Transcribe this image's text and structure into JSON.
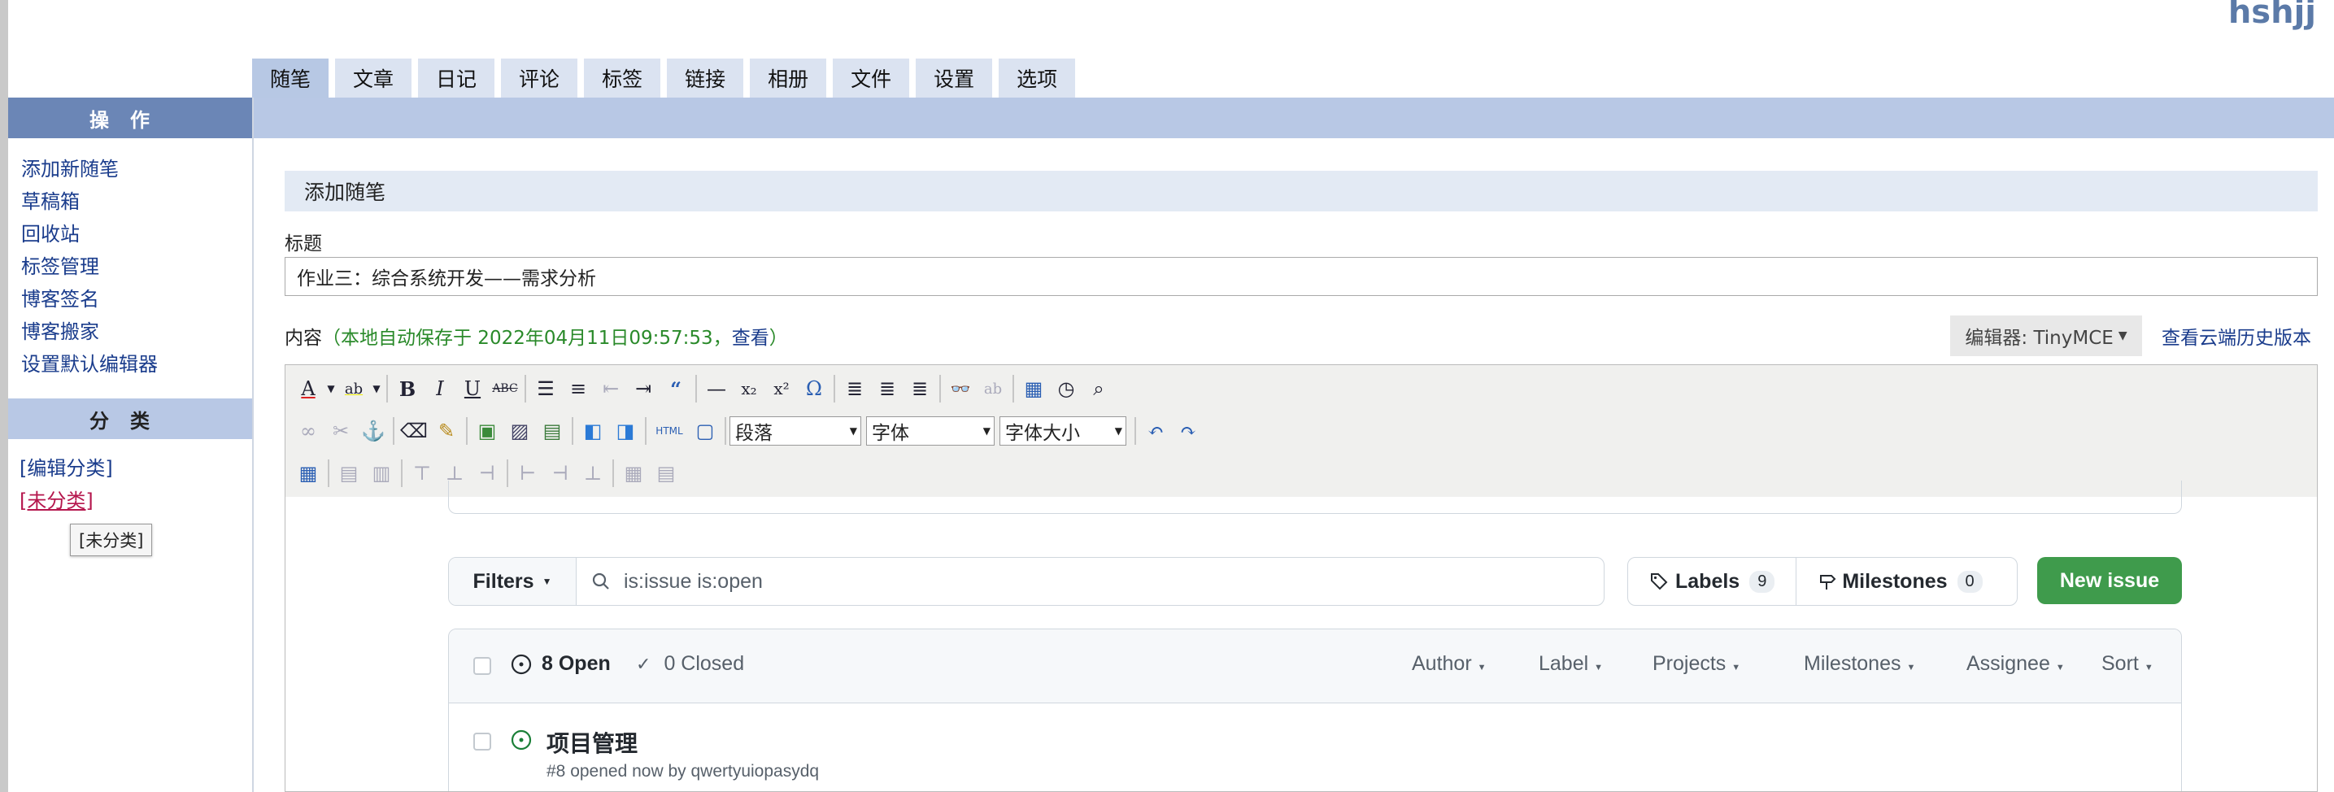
{
  "site_title": "hshjj",
  "tabs": [
    "随笔",
    "文章",
    "日记",
    "评论",
    "标签",
    "链接",
    "相册",
    "文件",
    "设置",
    "选项"
  ],
  "sidebar": {
    "ops_heading": "操作",
    "ops_links": [
      "添加新随笔",
      "草稿箱",
      "回收站",
      "标签管理",
      "博客签名",
      "博客搬家",
      "设置默认编辑器"
    ],
    "cat_heading": "分类",
    "cat_links": [
      "[编辑分类]",
      "[未分类]"
    ],
    "tooltip": "[未分类]"
  },
  "main": {
    "section_title": "添加随笔",
    "title_label": "标题",
    "title_value": "作业三：综合系统开发——需求分析",
    "content_label": "内容",
    "autosave_text": "（本地自动保存于 2022年04月11日09:57:53，",
    "view_link": "查看",
    "autosave_close": "）",
    "editor_select": "编辑器: TinyMCE",
    "cloud_history_link": "查看云端历史版本"
  },
  "toolbar": {
    "format_select": "段落",
    "font_select": "字体",
    "size_select": "字体大小",
    "html_label": "HTML"
  },
  "github": {
    "filters_label": "Filters",
    "search_value": "is:issue is:open",
    "labels_label": "Labels",
    "labels_count": "9",
    "milestones_label": "Milestones",
    "milestones_count": "0",
    "new_issue_label": "New issue",
    "open_label": "8 Open",
    "closed_label": "0 Closed",
    "header_filters": [
      "Author",
      "Label",
      "Projects",
      "Milestones",
      "Assignee",
      "Sort"
    ],
    "issue_title": "项目管理",
    "issue_meta": "#8 opened now by qwertyuiopasydq"
  },
  "colors": {
    "nav_heading_bg": "#6b86b6",
    "tab_bg": "#dbe3f1",
    "band_bg": "#b8c8e5",
    "link": "#1a3c8c",
    "autosave": "#2a8a2a",
    "new_issue_green": "#3f9b4c",
    "issue_open_green": "#1a7f37"
  }
}
